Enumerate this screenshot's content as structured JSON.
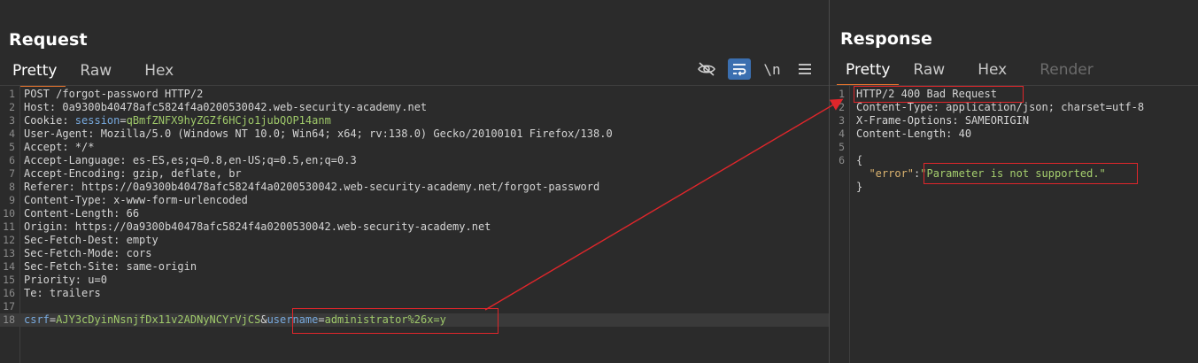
{
  "request": {
    "title": "Request",
    "tabs": [
      {
        "label": "Pretty",
        "active": true
      },
      {
        "label": "Raw",
        "active": false
      },
      {
        "label": "Hex",
        "active": false
      }
    ],
    "toolbar": {
      "hide_icon": "eye-slash-icon",
      "wrap_icon": "word-wrap-icon",
      "newline_label": "\\n",
      "menu_icon": "hamburger-menu-icon"
    },
    "lines": [
      {
        "num": "1",
        "text": "POST /forgot-password HTTP/2"
      },
      {
        "num": "2",
        "text": "Host: 0a9300b40478afc5824f4a0200530042.web-security-academy.net"
      },
      {
        "num": "3",
        "key": "Cookie: ",
        "cookie_name": "session",
        "eq": "=",
        "cookie_value": "qBmfZNFX9hyZGZf6HCjo1jubQOP14anm"
      },
      {
        "num": "4",
        "text": "User-Agent: Mozilla/5.0 (Windows NT 10.0; Win64; x64; rv:138.0) Gecko/20100101 Firefox/138.0"
      },
      {
        "num": "5",
        "text": "Accept: */*"
      },
      {
        "num": "6",
        "text": "Accept-Language: es-ES,es;q=0.8,en-US;q=0.5,en;q=0.3"
      },
      {
        "num": "7",
        "text": "Accept-Encoding: gzip, deflate, br"
      },
      {
        "num": "8",
        "text": "Referer: https://0a9300b40478afc5824f4a0200530042.web-security-academy.net/forgot-password"
      },
      {
        "num": "9",
        "text": "Content-Type: x-www-form-urlencoded"
      },
      {
        "num": "10",
        "text": "Content-Length: 66"
      },
      {
        "num": "11",
        "text": "Origin: https://0a9300b40478afc5824f4a0200530042.web-security-academy.net"
      },
      {
        "num": "12",
        "text": "Sec-Fetch-Dest: empty"
      },
      {
        "num": "13",
        "text": "Sec-Fetch-Mode: cors"
      },
      {
        "num": "14",
        "text": "Sec-Fetch-Site: same-origin"
      },
      {
        "num": "15",
        "text": "Priority: u=0"
      },
      {
        "num": "16",
        "text": "Te: trailers"
      },
      {
        "num": "17",
        "text": ""
      },
      {
        "num": "18",
        "p1_key": "csrf",
        "p1_eq": "=",
        "p1_val": "AJY3cDyinNsnjfDx11v2ADNyNCYrVjCS",
        "amp": "&",
        "p2_key": "username",
        "p2_eq": "=",
        "p2_val": "administrator%26x=y"
      }
    ]
  },
  "response": {
    "title": "Response",
    "tabs": [
      {
        "label": "Pretty",
        "active": true
      },
      {
        "label": "Raw",
        "active": false
      },
      {
        "label": "Hex",
        "active": false
      },
      {
        "label": "Render",
        "active": false,
        "disabled": true
      }
    ],
    "lines": [
      {
        "num": "1",
        "text": "HTTP/2 400 Bad Request"
      },
      {
        "num": "2",
        "text": "Content-Type: application/json; charset=utf-8"
      },
      {
        "num": "3",
        "text": "X-Frame-Options: SAMEORIGIN"
      },
      {
        "num": "4",
        "text": "Content-Length: 40"
      },
      {
        "num": "5",
        "text": ""
      },
      {
        "num": "6",
        "text": "{"
      },
      {
        "num": "",
        "indent": "  ",
        "json_key": "\"error\"",
        "colon": ":",
        "json_value": "\"Parameter is not supported.\""
      },
      {
        "num": "",
        "text": "}"
      }
    ]
  },
  "colors": {
    "background": "#2b2b2b",
    "accent_tab": "#e6742c",
    "annotation_red": "#e0262b",
    "param_key": "#78aadf",
    "param_value": "#9fc96a",
    "json_key": "#dbb36f"
  }
}
